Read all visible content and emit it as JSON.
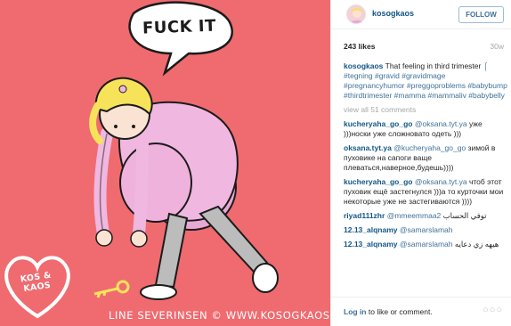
{
  "photo": {
    "speech": "FUCK IT",
    "logo": "KOS & KAOS",
    "credit": "LINE SEVERINSEN © WWW.KOSOGKAOS.NO",
    "bg_color": "#ef6b70"
  },
  "header": {
    "username": "kosogkaos",
    "follow_label": "FOLLOW"
  },
  "stats": {
    "likes": "243 likes",
    "age": "30w"
  },
  "caption": {
    "username": "kosogkaos",
    "text": "That feeling in third trimester",
    "hashtags": "⌠ #tegning #gravid #gravidmage #pregnancyhumor #preggoproblems #babybump #thirdtrimester #mamma #mammaliv #babybelly"
  },
  "view_all": "view all 51 comments",
  "comments": [
    {
      "user": "kucheryaha_go_go",
      "mention": "@oksana.tyt.ya",
      "text": "уже )))носки уже сложновато одеть )))"
    },
    {
      "user": "oksana.tyt.ya",
      "mention": "@kucheryaha_go_go",
      "text": "зимой в пуховике на сапоги ваще плеваться,наверное,будешь))))"
    },
    {
      "user": "kucheryaha_go_go",
      "mention": "@oksana.tyt.ya",
      "text": "чтоб этот пуховик ещё застегнулся )))а то курточки мои некоторые уже не застегиваются ))))"
    },
    {
      "user": "riyad111zhr",
      "mention": "@mmeemmaa2",
      "text": "توفي الحساب"
    },
    {
      "user": "12.13_alqnamy",
      "mention": "@samarslamah",
      "text": ""
    },
    {
      "user": "12.13_alqnamy",
      "mention": "@samarslamah",
      "text": "هيهه زي دعايه"
    }
  ],
  "footer": {
    "login_link": "Log in",
    "login_text": "to like or comment.",
    "more": "○○○"
  },
  "colors": {
    "link_blue": "#125688",
    "hashtag_blue": "#3f729b",
    "muted": "#a5a7aa"
  }
}
